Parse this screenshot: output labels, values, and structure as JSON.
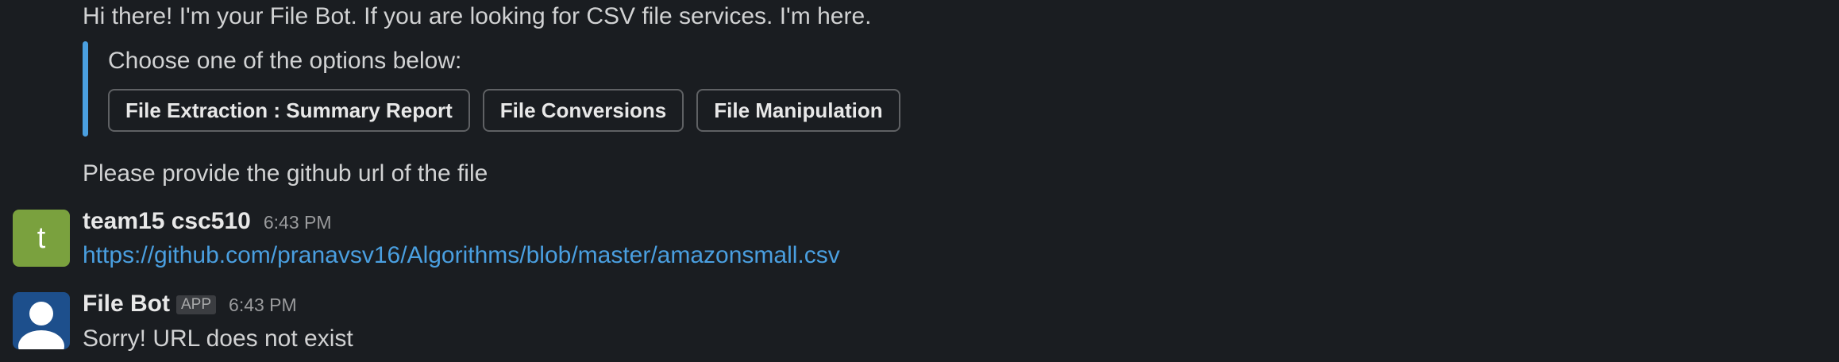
{
  "messages": {
    "intro": "Hi there! I'm your File Bot. If you are looking for CSV file services. I'm here.",
    "attachment": {
      "prompt": "Choose one of the options below:",
      "buttons": [
        "File Extraction : Summary Report",
        "File Conversions",
        "File Manipulation"
      ]
    },
    "request": "Please provide the github url of the file",
    "user_message": {
      "avatar_letter": "t",
      "sender": "team15 csc510",
      "time": "6:43 PM",
      "link": "https://github.com/pranavsv16/Algorithms/blob/master/amazonsmall.csv"
    },
    "bot_message": {
      "avatar_icon": "user-silhouette-icon",
      "sender": "File Bot",
      "badge": "APP",
      "time": "6:43 PM",
      "text": "Sorry! URL does not exist"
    }
  },
  "colors": {
    "background": "#1a1d21",
    "accent_bar": "#4a9fe0",
    "link": "#4a9fe0",
    "user_avatar": "#7aa13e",
    "bot_avatar": "#1d4f8c"
  }
}
